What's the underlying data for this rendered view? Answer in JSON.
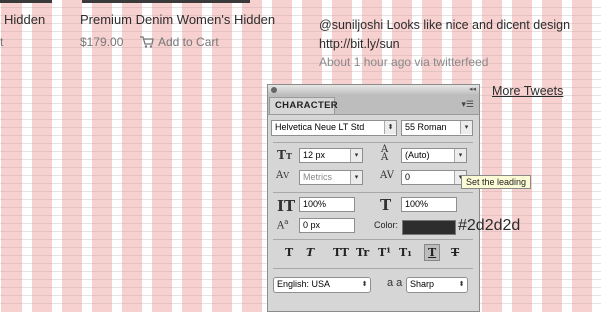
{
  "products": [
    {
      "name": "Hidden",
      "price": "t"
    },
    {
      "name": "Premium Denim Women's Hidden",
      "price": "$179.00",
      "cart_label": "Add to Cart"
    }
  ],
  "tweet": {
    "text_line1": "@suniljoshi Looks like nice and dicent design",
    "text_line2": "http://bit.ly/sun",
    "meta": "About 1 hour ago via twitterfeed",
    "more": "More Tweets"
  },
  "character_panel": {
    "tab": "CHARACTER",
    "font_family": "Helvetica Neue LT Std",
    "font_style": "55 Roman",
    "font_size": "12 px",
    "leading": "(Auto)",
    "kerning": "Metrics",
    "tracking": "0",
    "vertical_scale": "100%",
    "horizontal_scale": "100%",
    "baseline_shift": "0 px",
    "color_label": "Color:",
    "color_hex": "#2d2d2d",
    "color_display": "#2d2d2d",
    "style_buttons": [
      "T",
      "T",
      "TT",
      "Tr",
      "T¹",
      "T₁",
      "T",
      "T"
    ],
    "language": "English: USA",
    "aa_label": "a a",
    "antialias": "Sharp",
    "tooltip": "Set the leading"
  }
}
